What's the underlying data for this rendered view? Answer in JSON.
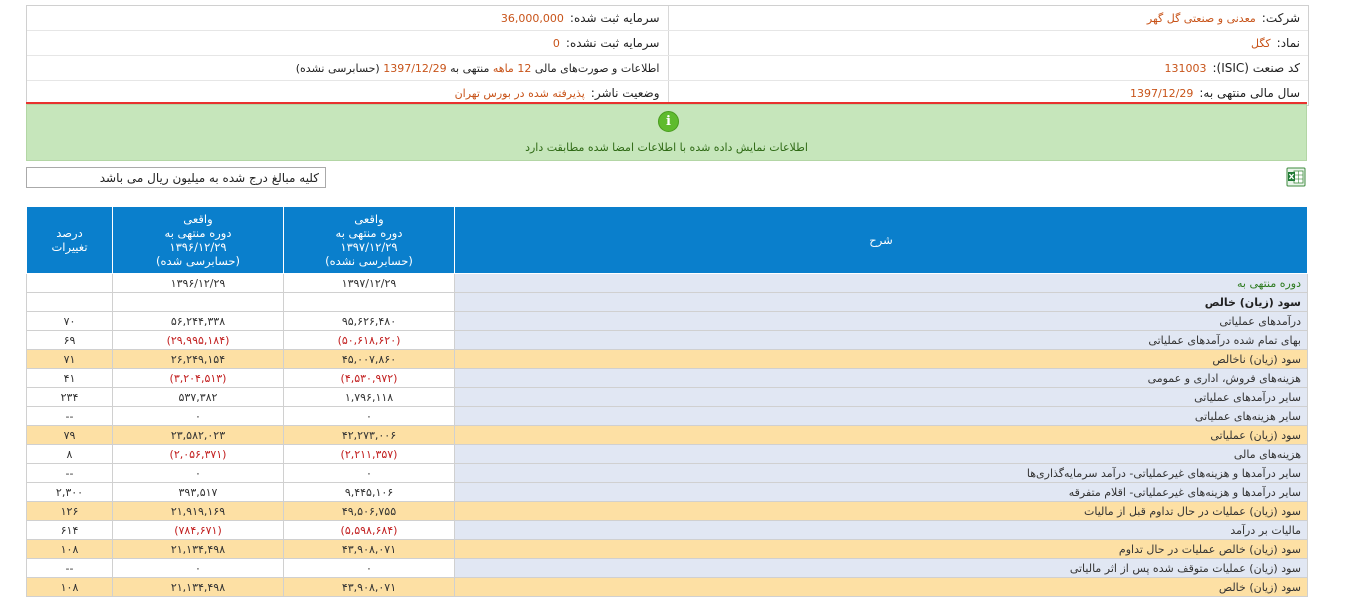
{
  "info": {
    "company_label": "شرکت:",
    "company_value": "معدنی و صنعتی گل گهر",
    "capital_label": "سرمایه ثبت شده:",
    "capital_value": "36,000,000",
    "symbol_label": "نماد:",
    "symbol_value": "کگل",
    "unregistered_capital_label": "سرمایه ثبت نشده:",
    "unregistered_capital_value": "0",
    "isic_label": "کد صنعت (ISIC):",
    "isic_value": "131003",
    "statements_prefix": "اطلاعات و صورت‌های مالی",
    "statements_period": "12 ماهه",
    "statements_mid": "منتهی به",
    "statements_date": "1397/12/29",
    "statements_suffix": "(حسابرسی نشده)",
    "fiscal_year_label": "سال مالی منتهی به:",
    "fiscal_year_value": "1397/12/29",
    "publisher_status_label": "وضعیت ناشر:",
    "publisher_status_value": "پذیرفته شده در بورس تهران"
  },
  "notice": {
    "icon": "info-icon",
    "text": "اطلاعات نمایش داده شده با اطلاعات امضا شده مطابقت دارد"
  },
  "units_note": "کلیه مبالغ درج شده به میلیون ریال می باشد",
  "export_icon": "excel-icon",
  "table": {
    "headers": {
      "desc": "شرح",
      "col1_l1": "واقعی",
      "col1_l2": "دوره منتهی به",
      "col1_l3": "۱۳۹۷/۱۲/۲۹",
      "col1_l4": "(حسابرسی نشده)",
      "col2_l1": "واقعی",
      "col2_l2": "دوره منتهی به",
      "col2_l3": "۱۳۹۶/۱۲/۲۹",
      "col2_l4": "(حسابرسی شده)",
      "pct_l1": "درصد",
      "pct_l2": "تغییرات"
    },
    "rows": [
      {
        "desc": "دوره منتهی به",
        "v1": "۱۳۹۷/۱۲/۲۹",
        "v2": "۱۳۹۶/۱۲/۲۹",
        "pct": ""
      },
      {
        "desc": "سود (زیان) خالص",
        "v1": "",
        "v2": "",
        "pct": ""
      },
      {
        "desc": "درآمدهای عملیاتی",
        "v1": "۹۵,۶۲۶,۴۸۰",
        "v2": "۵۶,۲۴۴,۳۳۸",
        "pct": "۷۰"
      },
      {
        "desc": "بهای تمام شده درآمدهای عملیاتی",
        "v1": "(۵۰,۶۱۸,۶۲۰)",
        "v2": "(۲۹,۹۹۵,۱۸۴)",
        "pct": "۶۹"
      },
      {
        "desc": "سود (زیان) ناخالص",
        "v1": "۴۵,۰۰۷,۸۶۰",
        "v2": "۲۶,۲۴۹,۱۵۴",
        "pct": "۷۱"
      },
      {
        "desc": "هزینه‌های فروش، اداری و عمومی",
        "v1": "(۴,۵۳۰,۹۷۲)",
        "v2": "(۳,۲۰۴,۵۱۳)",
        "pct": "۴۱"
      },
      {
        "desc": "سایر درآمدهای عملیاتی",
        "v1": "۱,۷۹۶,۱۱۸",
        "v2": "۵۳۷,۳۸۲",
        "pct": "۲۳۴"
      },
      {
        "desc": "سایر هزینه‌های عملیاتی",
        "v1": "۰",
        "v2": "۰",
        "pct": "--"
      },
      {
        "desc": "سود (زیان) عملیاتی",
        "v1": "۴۲,۲۷۳,۰۰۶",
        "v2": "۲۳,۵۸۲,۰۲۳",
        "pct": "۷۹"
      },
      {
        "desc": "هزینه‌های مالی",
        "v1": "(۲,۲۱۱,۳۵۷)",
        "v2": "(۲,۰۵۶,۳۷۱)",
        "pct": "۸"
      },
      {
        "desc": "سایر درآمدها و هزینه‌های غیرعملیاتی- درآمد سرمایه‌گذاری‌ها",
        "v1": "۰",
        "v2": "۰",
        "pct": "--"
      },
      {
        "desc": "سایر درآمدها و هزینه‌های غیرعملیاتی- اقلام متفرقه",
        "v1": "۹,۴۴۵,۱۰۶",
        "v2": "۳۹۳,۵۱۷",
        "pct": "۲,۳۰۰"
      },
      {
        "desc": "سود (زیان) عملیات در حال تداوم قبل از مالیات",
        "v1": "۴۹,۵۰۶,۷۵۵",
        "v2": "۲۱,۹۱۹,۱۶۹",
        "pct": "۱۲۶"
      },
      {
        "desc": "مالیات بر درآمد",
        "v1": "(۵,۵۹۸,۶۸۴)",
        "v2": "(۷۸۴,۶۷۱)",
        "pct": "۶۱۴"
      },
      {
        "desc": "سود (زیان) خالص عملیات در حال تداوم",
        "v1": "۴۳,۹۰۸,۰۷۱",
        "v2": "۲۱,۱۳۴,۴۹۸",
        "pct": "۱۰۸"
      },
      {
        "desc": "سود (زیان) عملیات متوقف شده پس از اثر مالیاتی",
        "v1": "۰",
        "v2": "۰",
        "pct": "--"
      },
      {
        "desc": "سود (زیان) خالص",
        "v1": "۴۳,۹۰۸,۰۷۱",
        "v2": "۲۱,۱۳۴,۴۹۸",
        "pct": "۱۰۸"
      }
    ]
  },
  "colors": {
    "header_blue": "#0a7fcc",
    "highlight_row": "#fde0a4",
    "desc_bg": "#e1e7f3",
    "negative": "#c21f1f",
    "link_orange": "#c8541a",
    "notice_green": "#c6e6bb"
  }
}
